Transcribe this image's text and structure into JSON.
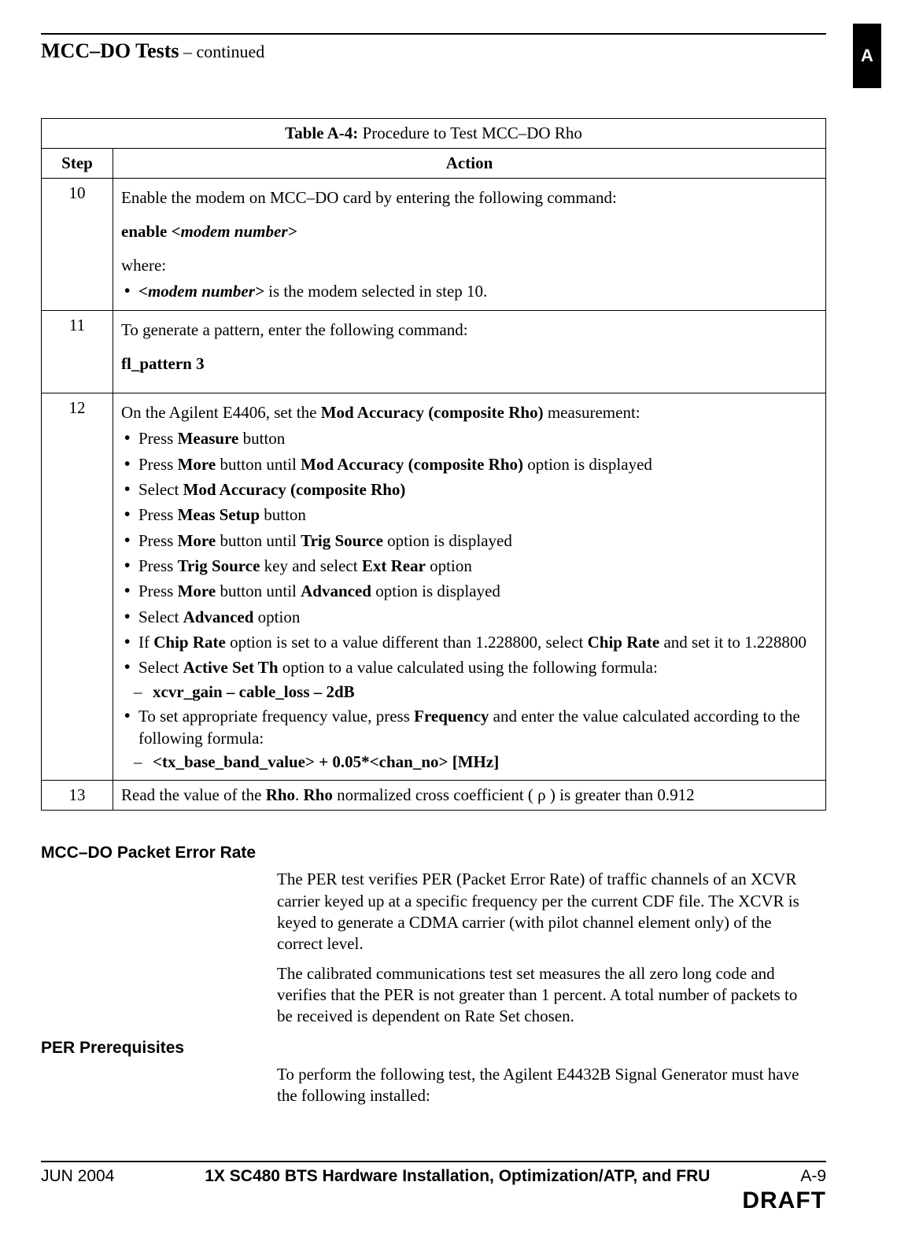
{
  "header": {
    "title_bold": "MCC–DO Tests",
    "title_cont": " – continued",
    "side_tab_letter": "A"
  },
  "table": {
    "caption_label": "Table A-4:",
    "caption_text": " Procedure to Test MCC–DO Rho",
    "col_step": "Step",
    "col_action": "Action",
    "rows": {
      "r10": {
        "step": "10",
        "p1": "Enable the modem on MCC–DO card by entering the following command:",
        "cmd_prefix": "enable ",
        "cmd_ph": "<modem number>",
        "where": "where:",
        "bullet_ph": "<modem number>",
        "bullet_text": " is the modem selected in step 10."
      },
      "r11": {
        "step": "11",
        "p1": "To generate a pattern, enter the following command:",
        "cmd": "fl_pattern 3"
      },
      "r12": {
        "step": "12",
        "intro_a": "On the Agilent E4406, set the ",
        "intro_b": "Mod Accuracy (composite Rho)",
        "intro_c": " measurement:",
        "b1_a": "Press ",
        "b1_b": "Measure",
        "b1_c": " button",
        "b2_a": "Press ",
        "b2_b": "More",
        "b2_c": " button until ",
        "b2_d": "Mod Accuracy (composite Rho)",
        "b2_e": " option is displayed",
        "b3_a": "Select ",
        "b3_b": "Mod Accuracy (composite Rho)",
        "b4_a": "Press ",
        "b4_b": "Meas Setup",
        "b4_c": " button",
        "b5_a": "Press ",
        "b5_b": "More",
        "b5_c": " button until ",
        "b5_d": "Trig Source",
        "b5_e": " option is displayed",
        "b6_a": "Press ",
        "b6_b": "Trig Source",
        "b6_c": " key and select ",
        "b6_d": "Ext Rear",
        "b6_e": " option",
        "b7_a": "Press ",
        "b7_b": "More",
        "b7_c": " button until ",
        "b7_d": "Advanced",
        "b7_e": " option is displayed",
        "b8_a": "Select ",
        "b8_b": "Advanced",
        "b8_c": " option",
        "b9_a": "If ",
        "b9_b": "Chip Rate",
        "b9_c": " option is set to a value different than 1.228800, select ",
        "b9_d": "Chip Rate",
        "b9_e": " and set it to 1.228800",
        "b10_a": "Select ",
        "b10_b": "Active Set Th",
        "b10_c": " option to a value calculated using the following formula:",
        "d1": "xcvr_gain – cable_loss – 2dB",
        "b11_a": "To set appropriate frequency value,  press ",
        "b11_b": "Frequency",
        "b11_c": " and enter the value calculated according to the following formula:",
        "d2": "<tx_base_band_value> + 0.05*<chan_no> [MHz]"
      },
      "r13": {
        "step": "13",
        "a": "Read the value of the ",
        "b": "Rho",
        "c": ". ",
        "d": "Rho",
        "e": " normalized cross coefficient ( ρ ) is greater than 0.912"
      }
    }
  },
  "sections": {
    "per_title": "MCC–DO Packet Error Rate",
    "per_p1": "The PER test verifies PER (Packet Error Rate) of traffic channels of an XCVR carrier keyed up at a specific frequency per the current CDF file. The XCVR is keyed to generate a CDMA carrier (with pilot channel element only) of the correct level.",
    "per_p2": "The calibrated communications test set measures the all zero long code and verifies that the PER is not greater than 1 percent. A total number of packets to be received is dependent on Rate Set chosen.",
    "prereq_title": "PER Prerequisites",
    "prereq_p1": "To perform the following test, the Agilent E4432B Signal Generator must have the following installed:"
  },
  "footer": {
    "date": "JUN 2004",
    "doc": "1X SC480 BTS Hardware Installation, Optimization/ATP, and FRU",
    "page": "A-9",
    "draft": "DRAFT"
  }
}
